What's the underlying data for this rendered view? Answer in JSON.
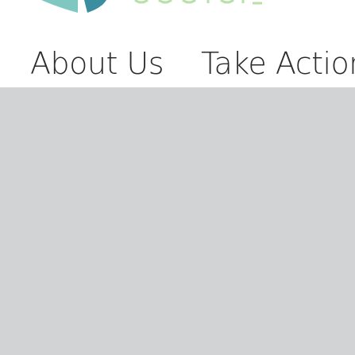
{
  "header": {
    "logo_icon": "teal-leaf-logo-icon",
    "nav": [
      {
        "label": "About Us"
      },
      {
        "label": "Take Action"
      }
    ]
  },
  "colors": {
    "logo_teal_light": "#7fc8c2",
    "logo_teal_dark": "#3a8ea0",
    "logo_green": "#b8e0a8",
    "content_background": "#d2d3d5",
    "nav_text": "#2b2b2b"
  }
}
